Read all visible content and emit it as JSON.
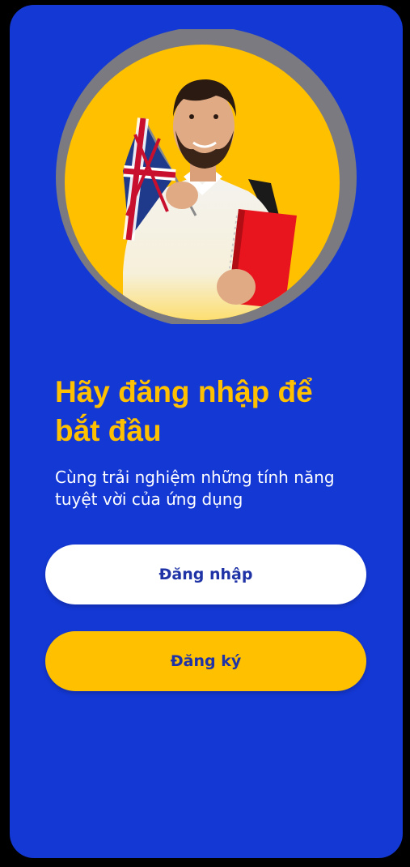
{
  "onboarding": {
    "headline": "Hãy đăng nhập để bắt đầu",
    "subtitle": "Cùng trải nghiệm những tính năng tuyệt vời của ứng dụng",
    "login_label": "Đăng nhập",
    "register_label": "Đăng ký"
  },
  "hero_image": {
    "description_icon": "man-with-uk-flag-illustration"
  },
  "colors": {
    "background": "#1438D4",
    "accent": "#FFC000",
    "button_text": "#1F33A6",
    "ring": "#7A7A80"
  }
}
